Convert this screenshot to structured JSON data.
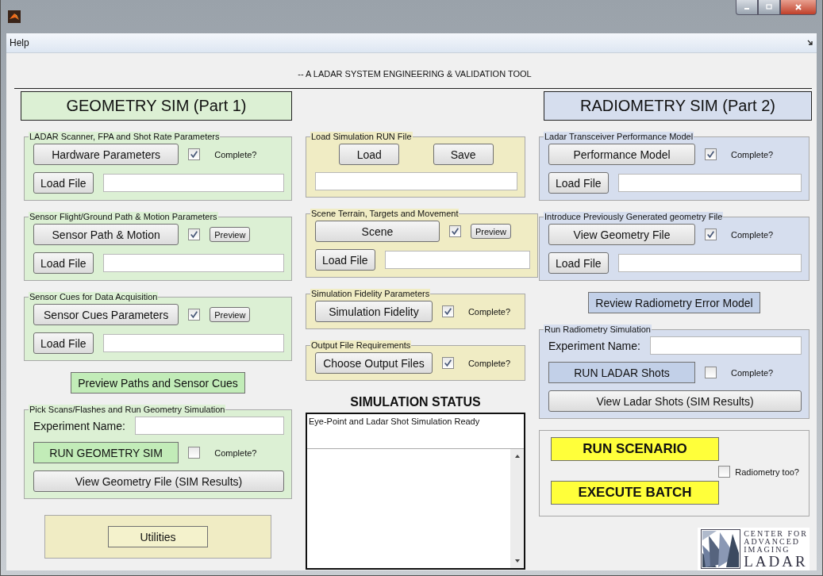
{
  "menu": [
    {
      "label": "Help"
    }
  ],
  "subtitle": "-- A LADAR SYSTEM ENGINEERING & VALIDATION TOOL",
  "headers": [
    {
      "text": "GEOMETRY SIM (Part 1)"
    },
    {
      "text": "RADIOMETRY SIM (Part 2)"
    }
  ],
  "columns": [
    {
      "blocks": [
        {
          "kind": "panel",
          "title": "LADAR Scanner, FPA and Shot Rate Parameters",
          "rows": [
            [
              {
                "kind": "button",
                "label": "Hardware Parameters"
              },
              {
                "kind": "checkbox",
                "checked": true,
                "label": "Complete?"
              }
            ],
            [
              {
                "kind": "button",
                "label": "Load File"
              },
              {
                "kind": "field"
              }
            ]
          ]
        },
        {
          "kind": "panel",
          "title": "Sensor Flight/Ground Path & Motion Parameters",
          "rows": [
            [
              {
                "kind": "button",
                "label": "Sensor Path & Motion"
              },
              {
                "kind": "checkbox",
                "checked": true
              },
              {
                "kind": "small_button",
                "label": "Preview"
              }
            ],
            [
              {
                "kind": "button",
                "label": "Load File"
              },
              {
                "kind": "field"
              }
            ]
          ]
        },
        {
          "kind": "panel",
          "title": "Sensor Cues for Data Acquisition",
          "rows": [
            [
              {
                "kind": "button",
                "label": "Sensor Cues Parameters"
              },
              {
                "kind": "checkbox",
                "checked": true
              },
              {
                "kind": "small_button",
                "label": "Preview"
              }
            ],
            [
              {
                "kind": "button",
                "label": "Load File"
              },
              {
                "kind": "field"
              }
            ]
          ]
        },
        {
          "kind": "accent_button",
          "label": "Preview Paths and Sensor Cues"
        },
        {
          "kind": "panel",
          "title": "Pick Scans/Flashes and Run Geometry Simulation",
          "rows": [
            [
              {
                "kind": "label",
                "text": "Experiment Name:"
              },
              {
                "kind": "field"
              }
            ],
            [
              {
                "kind": "run_button",
                "label": "RUN GEOMETRY SIM"
              },
              {
                "kind": "checkbox",
                "checked": false,
                "label": "Complete?"
              }
            ],
            [
              {
                "kind": "button",
                "label": "View Geometry File (SIM Results)"
              }
            ]
          ]
        },
        {
          "kind": "frame",
          "rows": [
            [
              {
                "kind": "utility_button",
                "label": "Utilities"
              }
            ]
          ]
        }
      ]
    },
    {
      "blocks": [
        {
          "kind": "panel",
          "title": "Load Simulation RUN File",
          "rows": [
            [
              {
                "kind": "button",
                "label": "Load"
              },
              {
                "kind": "button",
                "label": "Save"
              }
            ],
            [
              {
                "kind": "field"
              }
            ]
          ]
        },
        {
          "kind": "panel",
          "title": "Scene Terrain, Targets and Movement",
          "rows": [
            [
              {
                "kind": "button",
                "label": "Scene"
              },
              {
                "kind": "checkbox",
                "checked": true
              },
              {
                "kind": "small_button",
                "label": "Preview"
              }
            ],
            [
              {
                "kind": "button",
                "label": "Load File"
              },
              {
                "kind": "field"
              }
            ]
          ]
        },
        {
          "kind": "panel",
          "title": "Simulation Fidelity Parameters",
          "rows": [
            [
              {
                "kind": "button",
                "label": "Simulation Fidelity"
              },
              {
                "kind": "checkbox",
                "checked": true,
                "label": "Complete?"
              }
            ]
          ]
        },
        {
          "kind": "panel",
          "title": "Output File Requirements",
          "rows": [
            [
              {
                "kind": "button",
                "label": "Choose Output Files"
              },
              {
                "kind": "checkbox",
                "checked": true,
                "label": "Complete?"
              }
            ]
          ]
        },
        {
          "kind": "status",
          "title": "SIMULATION STATUS",
          "message": "Eye-Point and Ladar Shot Simulation Ready"
        }
      ]
    },
    {
      "blocks": [
        {
          "kind": "panel",
          "title": "Ladar Transceiver Performance Model",
          "rows": [
            [
              {
                "kind": "button",
                "label": "Performance Model"
              },
              {
                "kind": "checkbox",
                "checked": true,
                "label": "Complete?"
              }
            ],
            [
              {
                "kind": "button",
                "label": "Load File"
              },
              {
                "kind": "field"
              }
            ]
          ]
        },
        {
          "kind": "panel",
          "title": "Introduce Previously Generated geometry File",
          "rows": [
            [
              {
                "kind": "button",
                "label": "View Geometry File"
              },
              {
                "kind": "checkbox",
                "checked": true,
                "label": "Complete?"
              }
            ],
            [
              {
                "kind": "button",
                "label": "Load File"
              },
              {
                "kind": "field"
              }
            ]
          ]
        },
        {
          "kind": "accent_button",
          "label": "Review Radiometry Error Model"
        },
        {
          "kind": "panel",
          "title": "Run Radiometry Simulation",
          "rows": [
            [
              {
                "kind": "label",
                "text": "Experiment Name:"
              },
              {
                "kind": "field"
              }
            ],
            [
              {
                "kind": "run_button",
                "label": "RUN LADAR Shots"
              },
              {
                "kind": "checkbox",
                "checked": false,
                "label": "Complete?"
              }
            ],
            [
              {
                "kind": "button",
                "label": "View Ladar Shots (SIM Results)"
              }
            ]
          ]
        },
        {
          "kind": "scenario",
          "buttons": [
            {
              "label": "RUN SCENARIO"
            },
            {
              "label": "EXECUTE BATCH"
            }
          ],
          "option": {
            "checked": false,
            "label": "Radiometry too?"
          }
        },
        {
          "kind": "logo",
          "lines": [
            "CENTER FOR",
            "ADVANCED",
            "IMAGING",
            "LADAR"
          ]
        }
      ]
    }
  ]
}
